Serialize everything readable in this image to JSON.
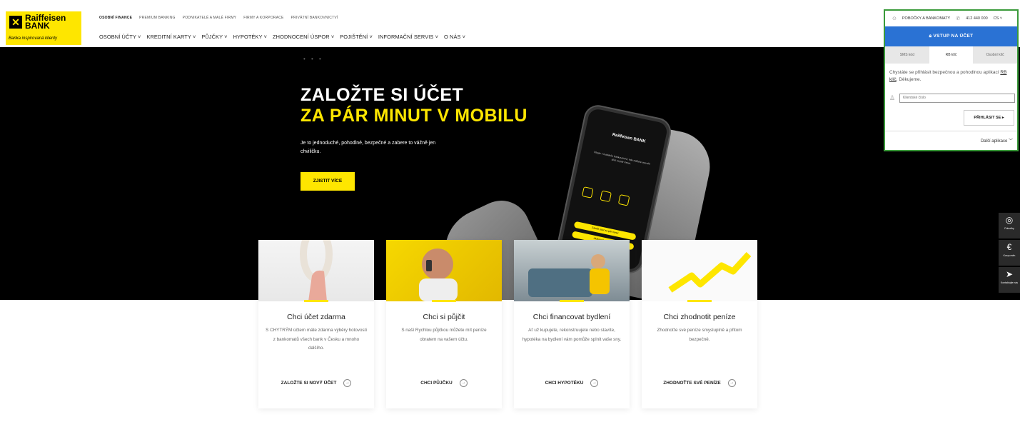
{
  "brand": {
    "name": "Raiffeisen BANK",
    "tagline": "Banka inspirovaná klienty"
  },
  "topnav": [
    "OSOBNÍ FINANCE",
    "PREMIUM BANKING",
    "PODNIKATELÉ A MALÉ FIRMY",
    "FIRMY A KORPORACE",
    "PRIVÁTNÍ BANKOVNICTVÍ"
  ],
  "mainnav": [
    "OSOBNÍ ÚČTY ˅",
    "KREDITNÍ KARTY ˅",
    "PŮJČKY ˅",
    "HYPOTÉKY ˅",
    "ZHODNOCENÍ ÚSPOR ˅",
    "POJIŠTĚNÍ ˅",
    "INFORMAČNÍ SERVIS ˅",
    "O NÁS ˅"
  ],
  "login": {
    "branches": "POBOČKY A BANKOMATY",
    "phone": "412 440 000",
    "lang": "CS ˅",
    "vstup": "VSTUP NA ÚČET",
    "tabs": [
      "SMS kód",
      "RB klíč",
      "Osobní klíč"
    ],
    "desc_start": "Chystáte se přihlásit bezpečnou a pohodlnou aplikací ",
    "desc_link": "RB klíč",
    "desc_end": ". Děkujeme.",
    "client_placeholder": "Klientské číslo",
    "submit": "PŘIHLÁSIT SE ▸",
    "more_apps": "Další aplikace ﹀"
  },
  "hero": {
    "dots": "• • •",
    "title1": "ZALOŽTE SI ÚČET",
    "title2": "ZA PÁR MINUT V MOBILU",
    "desc": "Je to jednoduché, pohodlné, bezpečné a zabere to vážně jen chviličku.",
    "button": "ZJISTIT VÍCE",
    "phone_logo": "Raiffeisen BANK",
    "phone_text": "Vítejte v mobilním bankovnictví, kde můžete vytvořit účet za pár minut.",
    "phone_btn1": "Založit účet za pár minut",
    "phone_btn2": "Aktivovat aplikaci"
  },
  "side": [
    {
      "icon": "◎",
      "label": "Pobočky"
    },
    {
      "icon": "€",
      "label": "Kurzy měn"
    },
    {
      "icon": "➤",
      "label": "Kontaktujte nás"
    }
  ],
  "cards": [
    {
      "title": "Chci účet zdarma",
      "text": "S CHYTRÝM účtem máte zdarma výběry hotovosti z bankomatů všech bank v Česku a mnoho dalšího.",
      "cta": "ZALOŽTE SI NOVÝ ÚČET"
    },
    {
      "title": "Chci si půjčit",
      "text": "S naší Rychlou půjčkou můžete mít peníze obratem na vašem účtu.",
      "cta": "CHCI PŮJČKU"
    },
    {
      "title": "Chci financovat bydlení",
      "text": "Ať už kupujete, rekonstruujete nebo stavíte, hypotéka na bydlení vám pomůže splnit vaše sny.",
      "cta": "CHCI HYPOTÉKU"
    },
    {
      "title": "Chci zhodnotit peníze",
      "text": "Zhodnoťte své peníze smysluplně a přitom bezpečně.",
      "cta": "ZHODNOŤTE SVÉ PENÍZE"
    }
  ],
  "colors": {
    "brand_yellow": "#fee600",
    "login_blue": "#2a72d4",
    "highlight_green": "#3a9a3a"
  }
}
